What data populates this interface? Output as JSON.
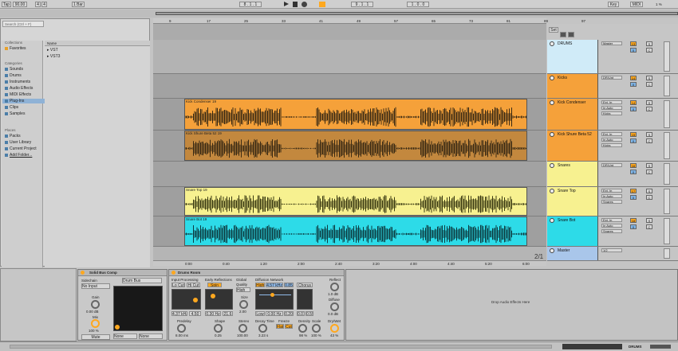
{
  "transport": {
    "tempo": "90.00",
    "time_sig_num": "4",
    "time_sig_den": "4",
    "quant": "1 Bar",
    "position": "8 . 1 . 1",
    "loop_start": "9 . 1 . 1",
    "loop_len": "1 . 0 . 0",
    "key": "Key",
    "midi": "MIDI",
    "cpu": "1 %",
    "tap": "Tap"
  },
  "browser": {
    "search_placeholder": "Search (Ctrl + F)",
    "collections_heading": "Collections",
    "favorites": "Favorites",
    "categories_heading": "Categories",
    "categories": [
      "Sounds",
      "Drums",
      "Instruments",
      "Audio Effects",
      "MIDI Effects",
      "Plug-Ins",
      "Clips",
      "Samples"
    ],
    "places_heading": "Places",
    "places": [
      "Packs",
      "User Library",
      "Current Project",
      "Add Folder..."
    ],
    "name_column": "Name",
    "files": [
      "VST",
      "VST3"
    ]
  },
  "ruler": [
    "9",
    "17",
    "25",
    "33",
    "41",
    "49",
    "57",
    "65",
    "73",
    "81",
    "89",
    "97"
  ],
  "time_ruler": [
    "0:00",
    "0:40",
    "1:20",
    "2:00",
    "2:40",
    "3:20",
    "4:00",
    "4:40",
    "5:20",
    "6:00"
  ],
  "set_button": "Set",
  "page_indicator": "2/1",
  "clips": {
    "kick_condenser": "Kick Condenser 19",
    "kick_shure": "Kick Shure Beta 52 19",
    "snare_top": "Snare Top 19",
    "snare_bot": "Snare Bot 19"
  },
  "tracks": [
    {
      "name": "DRUMS",
      "io1": "Master",
      "num": "13",
      "color": "#d0ebf8"
    },
    {
      "name": "Kicks",
      "io1": "DR/Unt",
      "num": "14",
      "color": "#f5a13a"
    },
    {
      "name": "Kick Condenser",
      "io1": "Ext. In",
      "io2": "In Auto",
      "io3": "Kicks",
      "num": "14",
      "color": "#f5a13a"
    },
    {
      "name": "Kick Shure Beta 52",
      "io1": "Ext. In",
      "io2": "In Auto",
      "io3": "Kicks",
      "num": "15",
      "color": "#f5a13a"
    },
    {
      "name": "Snares",
      "io1": "DR/Unt",
      "num": "16",
      "color": "#f7f190"
    },
    {
      "name": "Snare Top",
      "io1": "Ext. In",
      "io2": "In Auto",
      "io3": "Snares",
      "num": "17",
      "color": "#f7f190"
    },
    {
      "name": "Snare Bot",
      "io1": "Ext. In",
      "io2": "In Auto",
      "io3": "Snares",
      "num": "18",
      "color": "#2ddbe8"
    },
    {
      "name": "Master",
      "io1": "1/2",
      "num": "",
      "color": "#a9c6ea"
    }
  ],
  "comp": {
    "title": "Solid Bus Comp",
    "sidechain": "Sidechain",
    "input": "No Input",
    "gain": "Gain",
    "gain_val": "0.00 dB",
    "mix": "Mix",
    "mix_val": "100 %",
    "mute": "Mute",
    "preset": "Drum Bus",
    "none1": "None",
    "none2": "None"
  },
  "reverb": {
    "title": "Drums Room",
    "input_proc": "Input Processing",
    "lo_cut": "Lo Cut",
    "hi_cut": "Hi Cut",
    "freq1": "4.37 kHz",
    "q1": "4.50",
    "early": "Early Reflections",
    "spin": "Spin",
    "spin_freq": "0.30 Hz",
    "spin_amt": "21.6",
    "global": "Global",
    "quality": "Quality",
    "quality_val": "High",
    "size": "Size",
    "size_val": "2.00",
    "diffusion": "Diffusion Network",
    "high": "High",
    "high_freq": "4.57 kHz",
    "high_val": "0.85",
    "chorus": "Chorus",
    "low": "Low",
    "low_freq": "0.00 Hz",
    "low_val": "0.20",
    "chorus_amt": "0.01",
    "chorus_rate": "0.59",
    "predelay": "Predelay",
    "predelay_val": "8.00 ms",
    "shape": "Shape",
    "shape_val": "0.25",
    "stereo": "Stereo",
    "stereo_val": "100.00",
    "decay": "Decay Time",
    "decay_val": "3.23 s",
    "freeze": "Freeze",
    "flat": "Flat",
    "cut": "Cut",
    "density": "Density",
    "density_val": "98 %",
    "scale": "Scale",
    "scale_val": "100 %",
    "reflect": "Reflect",
    "reflect_val": "1.0 dB",
    "diffuse": "Diffuse",
    "diffuse_val": "0.0 dB",
    "drywet": "Dry/Wet",
    "drywet_val": "43 %"
  },
  "drop_text": "Drop Audio Effects Here",
  "status_track": "DRUMS",
  "colors": {
    "orange": "#f5a13a",
    "yellow": "#f7f190",
    "cyan": "#2ddbe8",
    "drums": "#d0ebf8",
    "master": "#a9c6ea",
    "accent": "#ffa81f"
  }
}
